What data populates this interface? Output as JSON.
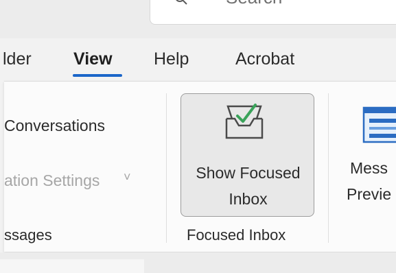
{
  "search": {
    "text": "Search"
  },
  "tabs": [
    {
      "label": "lder",
      "active": false
    },
    {
      "label": "View",
      "active": true
    },
    {
      "label": "Help",
      "active": false
    },
    {
      "label": "Acrobat",
      "active": false
    }
  ],
  "ribbon": {
    "conversations_label": "Conversations",
    "conversation_settings_label": "ation Settings",
    "conversation_settings_chevron": "˅",
    "messages_group_label": "ssages",
    "show_focused_inbox_line1": "Show Focused",
    "show_focused_inbox_line2": "Inbox",
    "focused_inbox_group_label": "Focused Inbox",
    "message_preview_line1": "Mess",
    "message_preview_line2": "Previe"
  },
  "colors": {
    "accent": "#1b66c9",
    "check": "#3aa35a",
    "disabled_text": "#a6a6a6"
  },
  "icons": {
    "search": "search-icon",
    "focused_inbox": "inbox-check-icon",
    "message_preview": "message-preview-icon"
  }
}
